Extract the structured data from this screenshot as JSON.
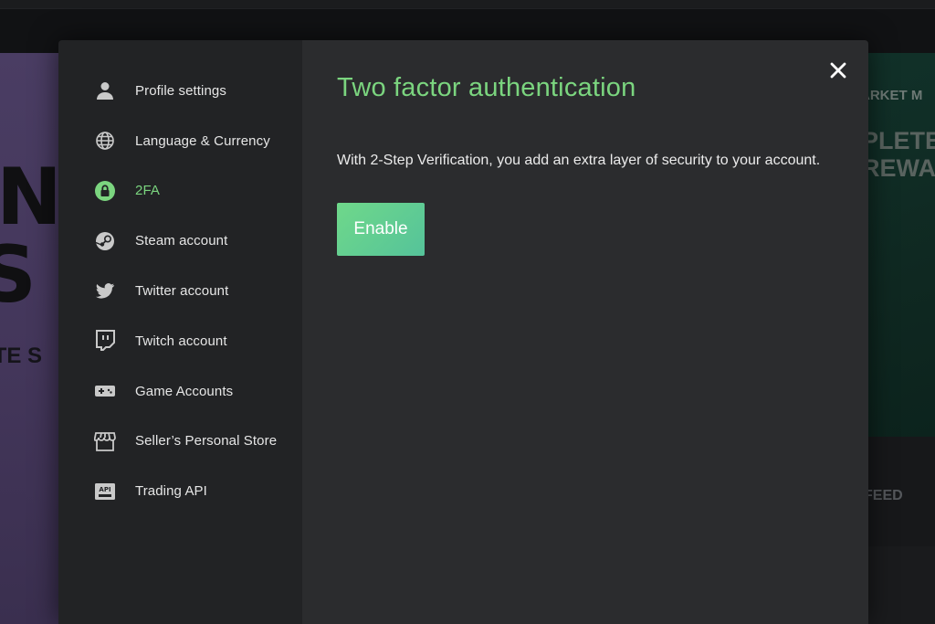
{
  "background": {
    "left_banner": {
      "line1": "N",
      "line2": "S",
      "subline": "ITE S"
    },
    "right_banner": {
      "line1": "ARKET M",
      "line2a": "PLETE",
      "line2b": "REWA"
    },
    "right_lower": {
      "feed": "FEED"
    }
  },
  "modal": {
    "title": "Two factor authentication",
    "description": "With 2-Step Verification, you add an extra layer of security to your account.",
    "enable_label": "Enable",
    "close_icon": "close-icon"
  },
  "sidebar": {
    "items": [
      {
        "label": "Profile settings",
        "icon": "user-icon",
        "active": false
      },
      {
        "label": "Language & Currency",
        "icon": "globe-icon",
        "active": false
      },
      {
        "label": "2FA",
        "icon": "lock-icon",
        "active": true
      },
      {
        "label": "Steam account",
        "icon": "steam-icon",
        "active": false
      },
      {
        "label": "Twitter account",
        "icon": "twitter-icon",
        "active": false
      },
      {
        "label": "Twitch account",
        "icon": "twitch-icon",
        "active": false
      },
      {
        "label": "Game Accounts",
        "icon": "gamepad-icon",
        "active": false
      },
      {
        "label": "Seller’s Personal Store",
        "icon": "store-icon",
        "active": false
      },
      {
        "label": "Trading API",
        "icon": "api-icon",
        "active": false
      }
    ]
  },
  "colors": {
    "accent": "#7bd57f",
    "button_gradient_start": "#6fd88a",
    "button_gradient_end": "#55c39a",
    "sidebar_bg": "#222325",
    "content_bg": "#2b2c2e"
  }
}
